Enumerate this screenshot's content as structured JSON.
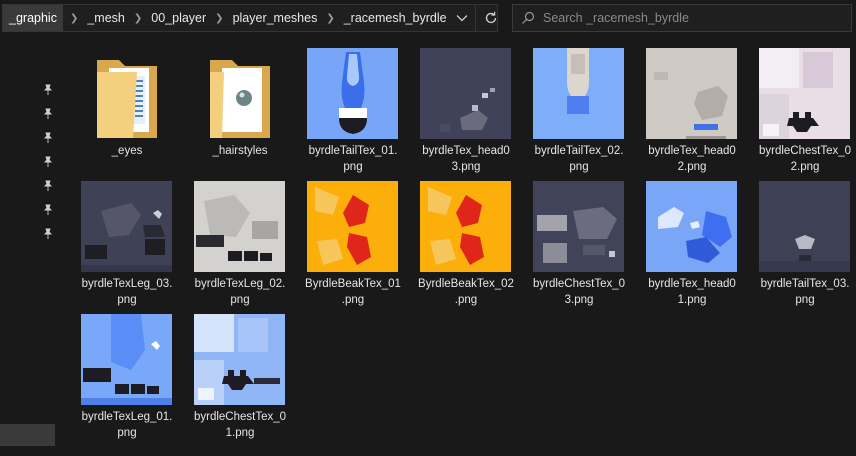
{
  "breadcrumb": [
    "_graphic",
    "_mesh",
    "00_player",
    "player_meshes",
    "_racemesh_byrdle"
  ],
  "search": {
    "placeholder": "Search _racemesh_byrdle"
  },
  "items": [
    {
      "line1": "_eyes",
      "line2": "",
      "kind": "folder",
      "preview": "eyes"
    },
    {
      "line1": "_hairstyles",
      "line2": "",
      "kind": "folder",
      "preview": "hair"
    },
    {
      "line1": "byrdleTailTex_01.",
      "line2": "png",
      "kind": "image",
      "preview": "tail01"
    },
    {
      "line1": "byrdleTex_head0",
      "line2": "3.png",
      "kind": "image",
      "preview": "head03"
    },
    {
      "line1": "byrdleTailTex_02.",
      "line2": "png",
      "kind": "image",
      "preview": "tail02"
    },
    {
      "line1": "byrdleTex_head0",
      "line2": "2.png",
      "kind": "image",
      "preview": "head02"
    },
    {
      "line1": "byrdleChestTex_0",
      "line2": "2.png",
      "kind": "image",
      "preview": "chest02"
    },
    {
      "line1": "byrdleTexLeg_03.",
      "line2": "png",
      "kind": "image",
      "preview": "leg03"
    },
    {
      "line1": "byrdleTexLeg_02.",
      "line2": "png",
      "kind": "image",
      "preview": "leg02"
    },
    {
      "line1": "ByrdleBeakTex_01",
      "line2": ".png",
      "kind": "image",
      "preview": "beak"
    },
    {
      "line1": "ByrdleBeakTex_02",
      "line2": ".png",
      "kind": "image",
      "preview": "beak"
    },
    {
      "line1": "byrdleChestTex_0",
      "line2": "3.png",
      "kind": "image",
      "preview": "chest03"
    },
    {
      "line1": "byrdleTex_head0",
      "line2": "1.png",
      "kind": "image",
      "preview": "head01"
    },
    {
      "line1": "byrdleTailTex_03.",
      "line2": "png",
      "kind": "image",
      "preview": "tail03"
    },
    {
      "line1": "byrdleTexLeg_01.",
      "line2": "png",
      "kind": "image",
      "preview": "leg01"
    },
    {
      "line1": "byrdleChestTex_0",
      "line2": "1.png",
      "kind": "image",
      "preview": "chest01"
    }
  ],
  "icons": {
    "chevron": "chevron-right-icon",
    "dropdown": "chevron-down-icon",
    "refresh": "refresh-icon",
    "search": "search-icon",
    "pin": "pin-icon"
  },
  "colors": {
    "background": "#191919",
    "navy": "#3f4156",
    "sky": "#7fa8f8",
    "beak_orange": "#fcae0a",
    "beak_red": "#e0261a"
  }
}
